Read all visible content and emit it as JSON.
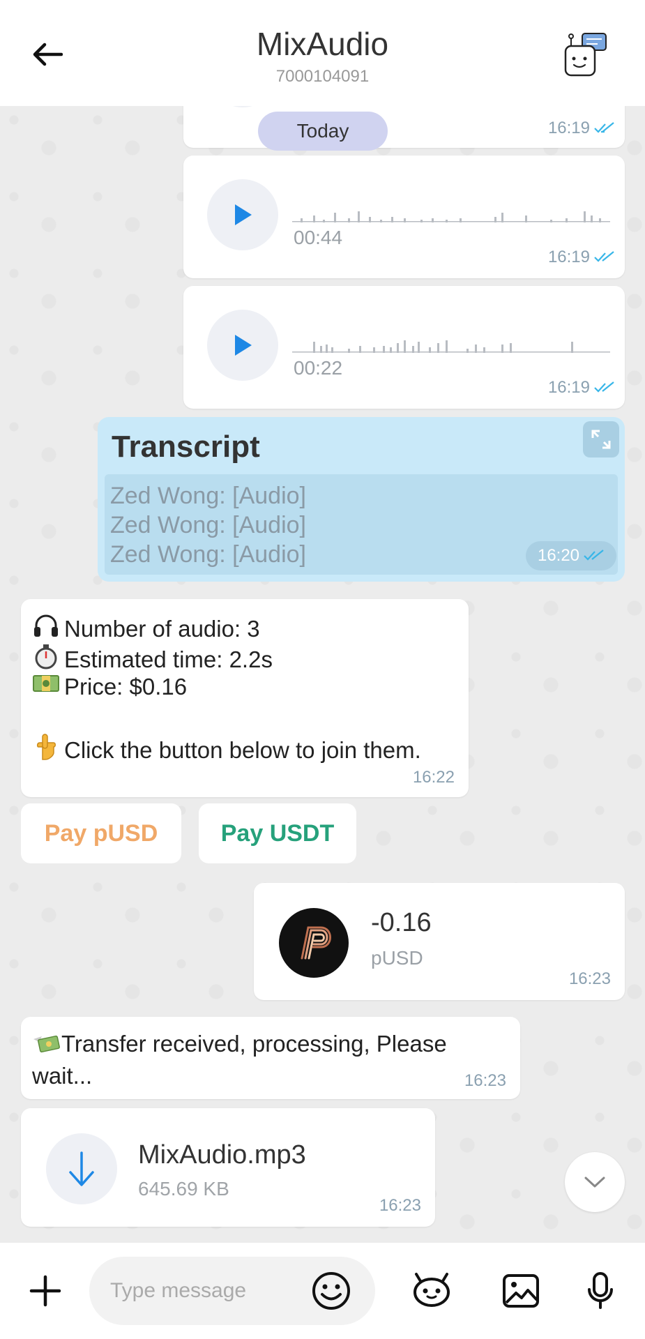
{
  "header": {
    "title": "MixAudio",
    "subtitle": "7000104091"
  },
  "chat": {
    "date_divider": "Today",
    "messages": [
      {
        "type": "audio",
        "duration": "",
        "time": "16:19",
        "status": "read"
      },
      {
        "type": "audio",
        "duration": "00:44",
        "time": "16:19",
        "status": "read"
      },
      {
        "type": "audio",
        "duration": "00:22",
        "time": "16:19",
        "status": "read"
      }
    ],
    "transcript": {
      "title": "Transcript",
      "lines": [
        "Zed Wong: [Audio]",
        "Zed Wong: [Audio]",
        "Zed Wong: [Audio]"
      ],
      "time": "16:20"
    },
    "info": {
      "audio_count": "Number of audio: 3",
      "estimated_time": "Estimated time: 2.2s",
      "price": "Price: $0.16",
      "instruction": "Click the button below to join them.",
      "time": "16:22"
    },
    "pay_buttons": {
      "pusd": "Pay pUSD",
      "usdt": "Pay USDT"
    },
    "transfer": {
      "amount": "-0.16",
      "asset": "pUSD",
      "time": "16:23"
    },
    "processing": {
      "text": "Transfer received, processing, Please wait...",
      "time": "16:23"
    },
    "file": {
      "name": "MixAudio.mp3",
      "size": "645.69 KB",
      "time": "16:23"
    }
  },
  "input": {
    "placeholder": "Type message"
  },
  "colors": {
    "accent_blue": "#1e88e5",
    "pusd_orange": "#f0a868",
    "usdt_green": "#26a17b",
    "transcript_bg": "#c9e9f9",
    "read_tick": "#38b6e8"
  }
}
